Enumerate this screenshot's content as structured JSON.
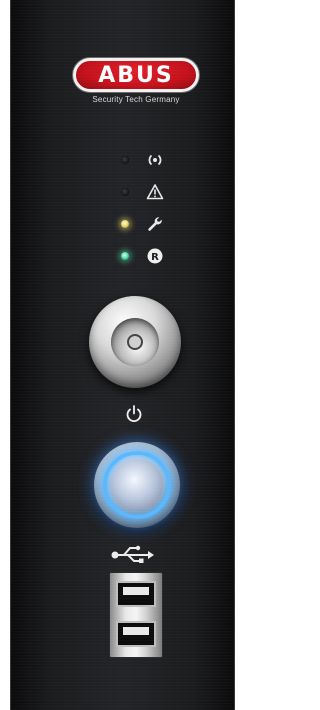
{
  "brand": {
    "logo_text": "ABUS",
    "tagline": "Security Tech Germany",
    "logo_color": "#c4121c"
  },
  "status_indicators": [
    {
      "id": "network",
      "icon": "wireless-signal-icon",
      "led_state": "off"
    },
    {
      "id": "alarm",
      "icon": "warning-triangle-icon",
      "led_state": "off"
    },
    {
      "id": "service",
      "icon": "wrench-icon",
      "led_state": "on",
      "led_color": "#e6d66a"
    },
    {
      "id": "recording",
      "icon": "record-r-icon",
      "label": "R",
      "led_state": "on",
      "led_color": "#4fd9a7"
    }
  ],
  "controls": {
    "key_switch": {
      "icon": "key-lock-icon"
    },
    "power": {
      "icon": "power-icon",
      "ring_color": "#5ab8ff"
    },
    "usb": {
      "icon": "usb-icon",
      "ports": 2
    }
  }
}
